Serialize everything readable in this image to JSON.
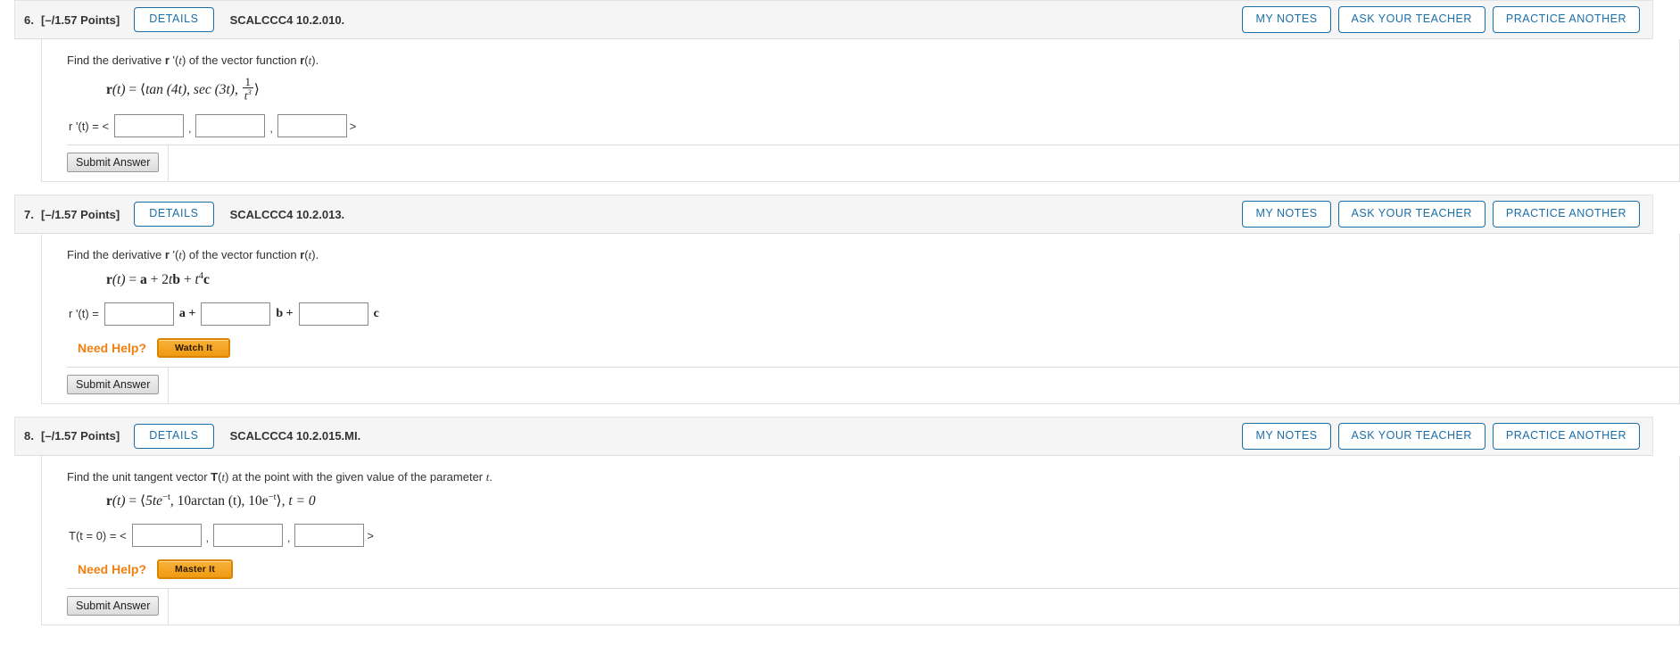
{
  "buttons": {
    "details": "DETAILS",
    "my_notes": "MY NOTES",
    "ask_your_teacher": "ASK YOUR TEACHER",
    "practice_another": "PRACTICE ANOTHER",
    "submit_answer": "Submit Answer",
    "watch_it": "Watch It",
    "master_it": "Master It"
  },
  "labels": {
    "need_help": "Need Help?",
    "open_angle": "<",
    "close_angle": ">",
    "comma": ","
  },
  "colors": {
    "accent_blue": "#1a6ea8",
    "help_orange": "#f08010",
    "header_bg": "#f5f5f5"
  },
  "questions": [
    {
      "number": "6.",
      "points": "[–/1.57 Points]",
      "code": "SCALCCC4 10.2.010.",
      "prompt_parts": {
        "p1": "Find the derivative ",
        "bold1": "r",
        "p2": " '(",
        "italic1": "t",
        "p3": ") of the vector function ",
        "bold2": "r",
        "p4": "(",
        "italic2": "t",
        "p5": ")."
      },
      "formula_plain": "r(t) = <tan(4t), sec(3t), 1/t^3>",
      "formula": {
        "lhs_bold": "r",
        "lhs_var": "(t)",
        "eq": "=",
        "comp1": "tan (4t)",
        "comp2": "sec (3t)",
        "comp3_num": "1",
        "comp3_den": "t",
        "comp3_den_exp": "3"
      },
      "answer_label_plain": "r '(t) = <",
      "answer_boxes": [
        "",
        "",
        ""
      ],
      "answer_placeholders": [
        "",
        "",
        ""
      ],
      "has_need_help": false,
      "help_button": null
    },
    {
      "number": "7.",
      "points": "[–/1.57 Points]",
      "code": "SCALCCC4 10.2.013.",
      "prompt_parts": {
        "p1": "Find the derivative ",
        "bold1": "r",
        "p2": " '(",
        "italic1": "t",
        "p3": ") of the vector function ",
        "bold2": "r",
        "p4": "(",
        "italic2": "t",
        "p5": ")."
      },
      "formula_plain": "r(t) = a + 2tb + t^4 c",
      "formula": {
        "lhs_bold": "r",
        "lhs_var": "(t)",
        "eq": "=",
        "term1": "a",
        "plus1": "+",
        "term2_coef": "2",
        "term2_var": "t",
        "term2_bold": "b",
        "plus2": "+",
        "term3_var": "t",
        "term3_exp": "4",
        "term3_bold": "c"
      },
      "answer_label_plain": "r '(t) =",
      "answer_boxes": [
        "",
        "",
        ""
      ],
      "basis_labels": [
        "a +",
        "b +",
        "c"
      ],
      "has_need_help": true,
      "help_button": "Watch It"
    },
    {
      "number": "8.",
      "points": "[–/1.57 Points]",
      "code": "SCALCCC4 10.2.015.MI.",
      "prompt_parts": {
        "p1": "Find the unit tangent vector ",
        "bold1": "T",
        "p2": "(",
        "italic1": "t",
        "p3": ") at the point with the given value of the parameter ",
        "italic2": "t",
        "p4": "."
      },
      "formula_plain": "r(t) = <5te^-t, 10arctan(t), 10e^-t>, t = 0",
      "formula": {
        "lhs_bold": "r",
        "lhs_var": "(t)",
        "eq": "=",
        "comp1": "5te",
        "comp1_exp": "−t",
        "comp2": "10arctan (t)",
        "comp3": "10e",
        "comp3_exp": "−t",
        "tail": ", t = 0"
      },
      "answer_label_plain": "T(t = 0) = <",
      "answer_boxes": [
        "",
        "",
        ""
      ],
      "has_need_help": true,
      "help_button": "Master It"
    }
  ]
}
